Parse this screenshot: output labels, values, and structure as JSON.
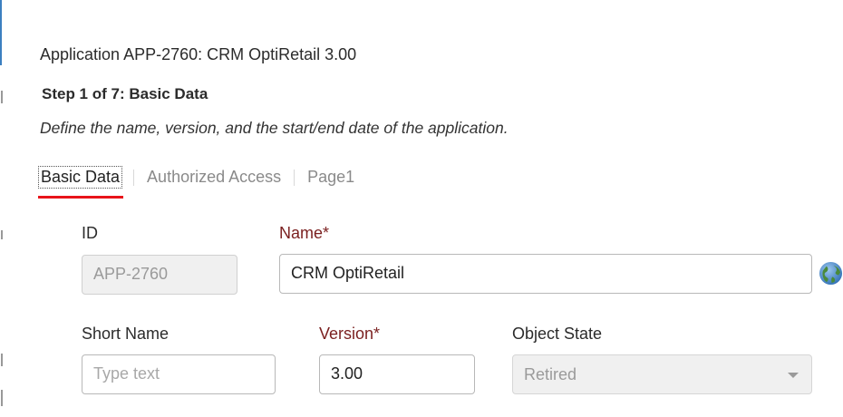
{
  "header": {
    "title": "Application APP-2760: CRM OptiRetail 3.00"
  },
  "step": {
    "title": "Step 1 of 7: Basic Data",
    "description": "Define the name, version, and the start/end date of the application."
  },
  "tabs": [
    {
      "label": "Basic Data",
      "active": true
    },
    {
      "label": "Authorized Access",
      "active": false
    },
    {
      "label": "Page1",
      "active": false
    }
  ],
  "form": {
    "id": {
      "label": "ID",
      "value": "APP-2760"
    },
    "name": {
      "label": "Name*",
      "value": "CRM OptiRetail"
    },
    "short_name": {
      "label": "Short Name",
      "placeholder": "Type text"
    },
    "version": {
      "label": "Version*",
      "value": "3.00"
    },
    "object_state": {
      "label": "Object State",
      "value": "Retired"
    }
  },
  "icons": {
    "translation": "globe-icon"
  },
  "colors": {
    "active_tab_underline": "#e8141a",
    "required_label": "#7a1f1f",
    "left_accent": "#3c7fc0"
  }
}
